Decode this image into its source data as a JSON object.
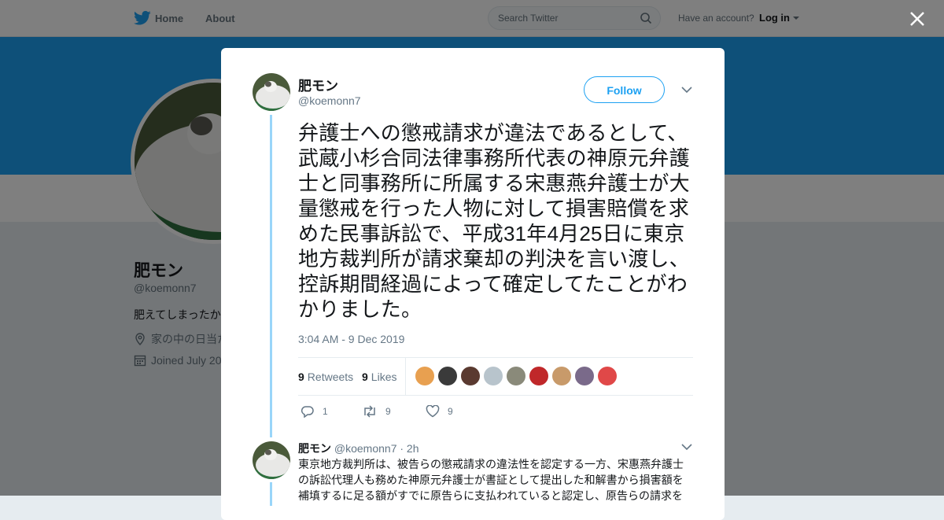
{
  "nav": {
    "home_label": "Home",
    "about_label": "About",
    "search_placeholder": "Search Twitter",
    "account_prompt": "Have an account?",
    "login_label": "Log in"
  },
  "profile": {
    "name": "肥モン",
    "handle": "@koemonn7",
    "bio": "肥えてしまったか",
    "location": "家の中の日当た",
    "joined": "Joined July 20"
  },
  "tweet": {
    "author_name": "肥モン",
    "author_handle": "@koemonn7",
    "follow_label": "Follow",
    "text": "弁護士への懲戒請求が違法であるとして、武蔵小杉合同法律事務所代表の神原元弁護士と同事務所に所属する宋惠燕弁護士が大量懲戒を行った人物に対して損害賠償を求めた民事訴訟で、平成31年4月25日に東京地方裁判所が請求棄却の判決を言い渡し、控訴期間経過によって確定してたことがわかりました。",
    "timestamp": "3:04 AM - 9 Dec 2019",
    "retweets_count": "9",
    "retweets_label": "Retweets",
    "likes_count": "9",
    "likes_label": "Likes",
    "reply_count": "1",
    "retweet_action_count": "9",
    "like_action_count": "9"
  },
  "reply": {
    "author_name": "肥モン",
    "author_handle": "@koemonn7",
    "time": "· 2h",
    "text": "東京地方裁判所は、被告らの懲戒請求の違法性を認定する一方、宋惠燕弁護士の訴訟代理人も務めた神原元弁護士が書証として提出した和解書から損害額を補填するに足る額がすでに原告らに支払われていると認定し、原告らの請求を"
  },
  "colors": {
    "brand": "#1da1f2",
    "thread": "#99d5f9",
    "muted": "#657786"
  }
}
